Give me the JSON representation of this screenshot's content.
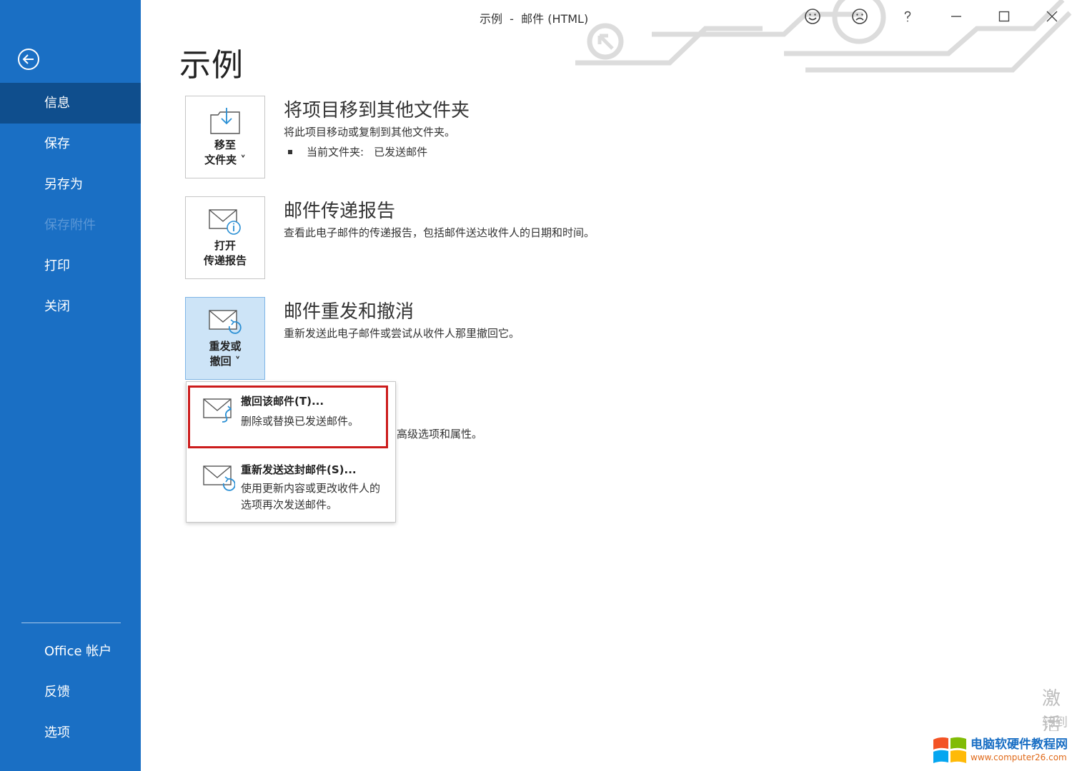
{
  "window": {
    "title": "示例  -  邮件 (HTML)"
  },
  "sidebar": {
    "items": [
      {
        "label": "信息",
        "state": "active"
      },
      {
        "label": "保存",
        "state": "normal"
      },
      {
        "label": "另存为",
        "state": "normal"
      },
      {
        "label": "保存附件",
        "state": "disabled"
      },
      {
        "label": "打印",
        "state": "normal"
      },
      {
        "label": "关闭",
        "state": "normal"
      }
    ],
    "bottom_items": [
      {
        "label": "Office 帐户"
      },
      {
        "label": "反馈"
      },
      {
        "label": "选项"
      }
    ]
  },
  "page": {
    "title": "示例"
  },
  "sections": {
    "move": {
      "button_line1": "移至",
      "button_line2": "文件夹 ˅",
      "title": "将项目移到其他文件夹",
      "desc": "将此项目移动或复制到其他文件夹。",
      "current_folder_label": "当前文件夹:",
      "current_folder_value": "已发送邮件"
    },
    "report": {
      "button_line1": "打开",
      "button_line2": "传递报告",
      "title": "邮件传递报告",
      "desc": "查看此电子邮件的传递报告，包括邮件送达收件人的日期和时间。"
    },
    "resend": {
      "button_line1": "重发或",
      "button_line2": "撤回 ˅",
      "title": "邮件重发和撤消",
      "desc": "重新发送此电子邮件或尝试从收件人那里撤回它。"
    },
    "hidden_fragment": "高级选项和属性。"
  },
  "dropdown": {
    "recall": {
      "title": "撤回该邮件(T)...",
      "desc": "删除或替换已发送邮件。"
    },
    "resend": {
      "title": "重新发送这封邮件(S)...",
      "desc": "使用更新内容或更改收件人的选项再次发送邮件。"
    }
  },
  "activation": {
    "line1": "激活",
    "line2": "转到"
  },
  "watermark": {
    "line1": "电脑软硬件教程网",
    "line2": "www.computer26.com"
  },
  "colors": {
    "sidebar": "#1a6fc4",
    "sidebar_active": "#0f4e8d",
    "highlight": "#cc1c1c",
    "tile_active": "#cde4f7"
  }
}
